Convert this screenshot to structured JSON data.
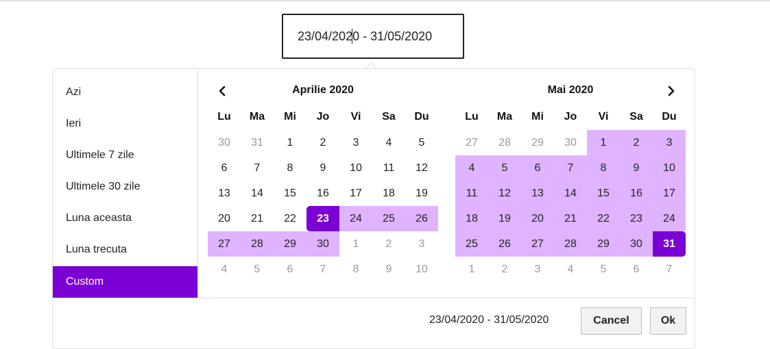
{
  "input": {
    "value_before_caret": "23/04/202",
    "value_after_caret": "0 - 31/05/2020"
  },
  "ranges": [
    "Azi",
    "Ieri",
    "Ultimele 7 zile",
    "Ultimele 30 zile",
    "Luna aceasta",
    "Luna trecuta",
    "Custom"
  ],
  "active_range": "Custom",
  "calendars": [
    {
      "title": "Aprilie 2020",
      "weekdays": [
        "Lu",
        "Ma",
        "Mi",
        "Jo",
        "Vi",
        "Sa",
        "Du"
      ],
      "weeks": [
        [
          {
            "d": "30",
            "off": true
          },
          {
            "d": "31",
            "off": true
          },
          {
            "d": "1"
          },
          {
            "d": "2"
          },
          {
            "d": "3"
          },
          {
            "d": "4"
          },
          {
            "d": "5"
          }
        ],
        [
          {
            "d": "6"
          },
          {
            "d": "7"
          },
          {
            "d": "8"
          },
          {
            "d": "9"
          },
          {
            "d": "10"
          },
          {
            "d": "11"
          },
          {
            "d": "12"
          }
        ],
        [
          {
            "d": "13"
          },
          {
            "d": "14"
          },
          {
            "d": "15"
          },
          {
            "d": "16"
          },
          {
            "d": "17"
          },
          {
            "d": "18"
          },
          {
            "d": "19"
          }
        ],
        [
          {
            "d": "20"
          },
          {
            "d": "21"
          },
          {
            "d": "22"
          },
          {
            "d": "23",
            "state": "start"
          },
          {
            "d": "24",
            "state": "in"
          },
          {
            "d": "25",
            "state": "in"
          },
          {
            "d": "26",
            "state": "in"
          }
        ],
        [
          {
            "d": "27",
            "state": "in"
          },
          {
            "d": "28",
            "state": "in"
          },
          {
            "d": "29",
            "state": "in"
          },
          {
            "d": "30",
            "state": "in"
          },
          {
            "d": "1",
            "off": true
          },
          {
            "d": "2",
            "off": true
          },
          {
            "d": "3",
            "off": true
          }
        ],
        [
          {
            "d": "4",
            "off": true
          },
          {
            "d": "5",
            "off": true
          },
          {
            "d": "6",
            "off": true
          },
          {
            "d": "7",
            "off": true
          },
          {
            "d": "8",
            "off": true
          },
          {
            "d": "9",
            "off": true
          },
          {
            "d": "10",
            "off": true
          }
        ]
      ]
    },
    {
      "title": "Mai 2020",
      "weekdays": [
        "Lu",
        "Ma",
        "Mi",
        "Jo",
        "Vi",
        "Sa",
        "Du"
      ],
      "weeks": [
        [
          {
            "d": "27",
            "off": true
          },
          {
            "d": "28",
            "off": true
          },
          {
            "d": "29",
            "off": true
          },
          {
            "d": "30",
            "off": true
          },
          {
            "d": "1",
            "state": "in"
          },
          {
            "d": "2",
            "state": "in"
          },
          {
            "d": "3",
            "state": "in"
          }
        ],
        [
          {
            "d": "4",
            "state": "in"
          },
          {
            "d": "5",
            "state": "in"
          },
          {
            "d": "6",
            "state": "in"
          },
          {
            "d": "7",
            "state": "in"
          },
          {
            "d": "8",
            "state": "in"
          },
          {
            "d": "9",
            "state": "in"
          },
          {
            "d": "10",
            "state": "in"
          }
        ],
        [
          {
            "d": "11",
            "state": "in"
          },
          {
            "d": "12",
            "state": "in"
          },
          {
            "d": "13",
            "state": "in"
          },
          {
            "d": "14",
            "state": "in"
          },
          {
            "d": "15",
            "state": "in"
          },
          {
            "d": "16",
            "state": "in"
          },
          {
            "d": "17",
            "state": "in"
          }
        ],
        [
          {
            "d": "18",
            "state": "in"
          },
          {
            "d": "19",
            "state": "in"
          },
          {
            "d": "20",
            "state": "in"
          },
          {
            "d": "21",
            "state": "in"
          },
          {
            "d": "22",
            "state": "in"
          },
          {
            "d": "23",
            "state": "in"
          },
          {
            "d": "24",
            "state": "in"
          }
        ],
        [
          {
            "d": "25",
            "state": "in"
          },
          {
            "d": "26",
            "state": "in"
          },
          {
            "d": "27",
            "state": "in"
          },
          {
            "d": "28",
            "state": "in"
          },
          {
            "d": "29",
            "state": "in"
          },
          {
            "d": "30",
            "state": "in"
          },
          {
            "d": "31",
            "state": "end"
          }
        ],
        [
          {
            "d": "1",
            "off": true
          },
          {
            "d": "2",
            "off": true
          },
          {
            "d": "3",
            "off": true
          },
          {
            "d": "4",
            "off": true
          },
          {
            "d": "5",
            "off": true
          },
          {
            "d": "6",
            "off": true
          },
          {
            "d": "7",
            "off": true
          }
        ]
      ]
    }
  ],
  "footer": {
    "range_text": "23/04/2020 - 31/05/2020",
    "cancel_label": "Cancel",
    "ok_label": "Ok"
  },
  "colors": {
    "accent": "#7b00d4",
    "range": "#dfb3ff"
  },
  "icons": {
    "prev": "chevron-left-icon",
    "next": "chevron-right-icon"
  }
}
